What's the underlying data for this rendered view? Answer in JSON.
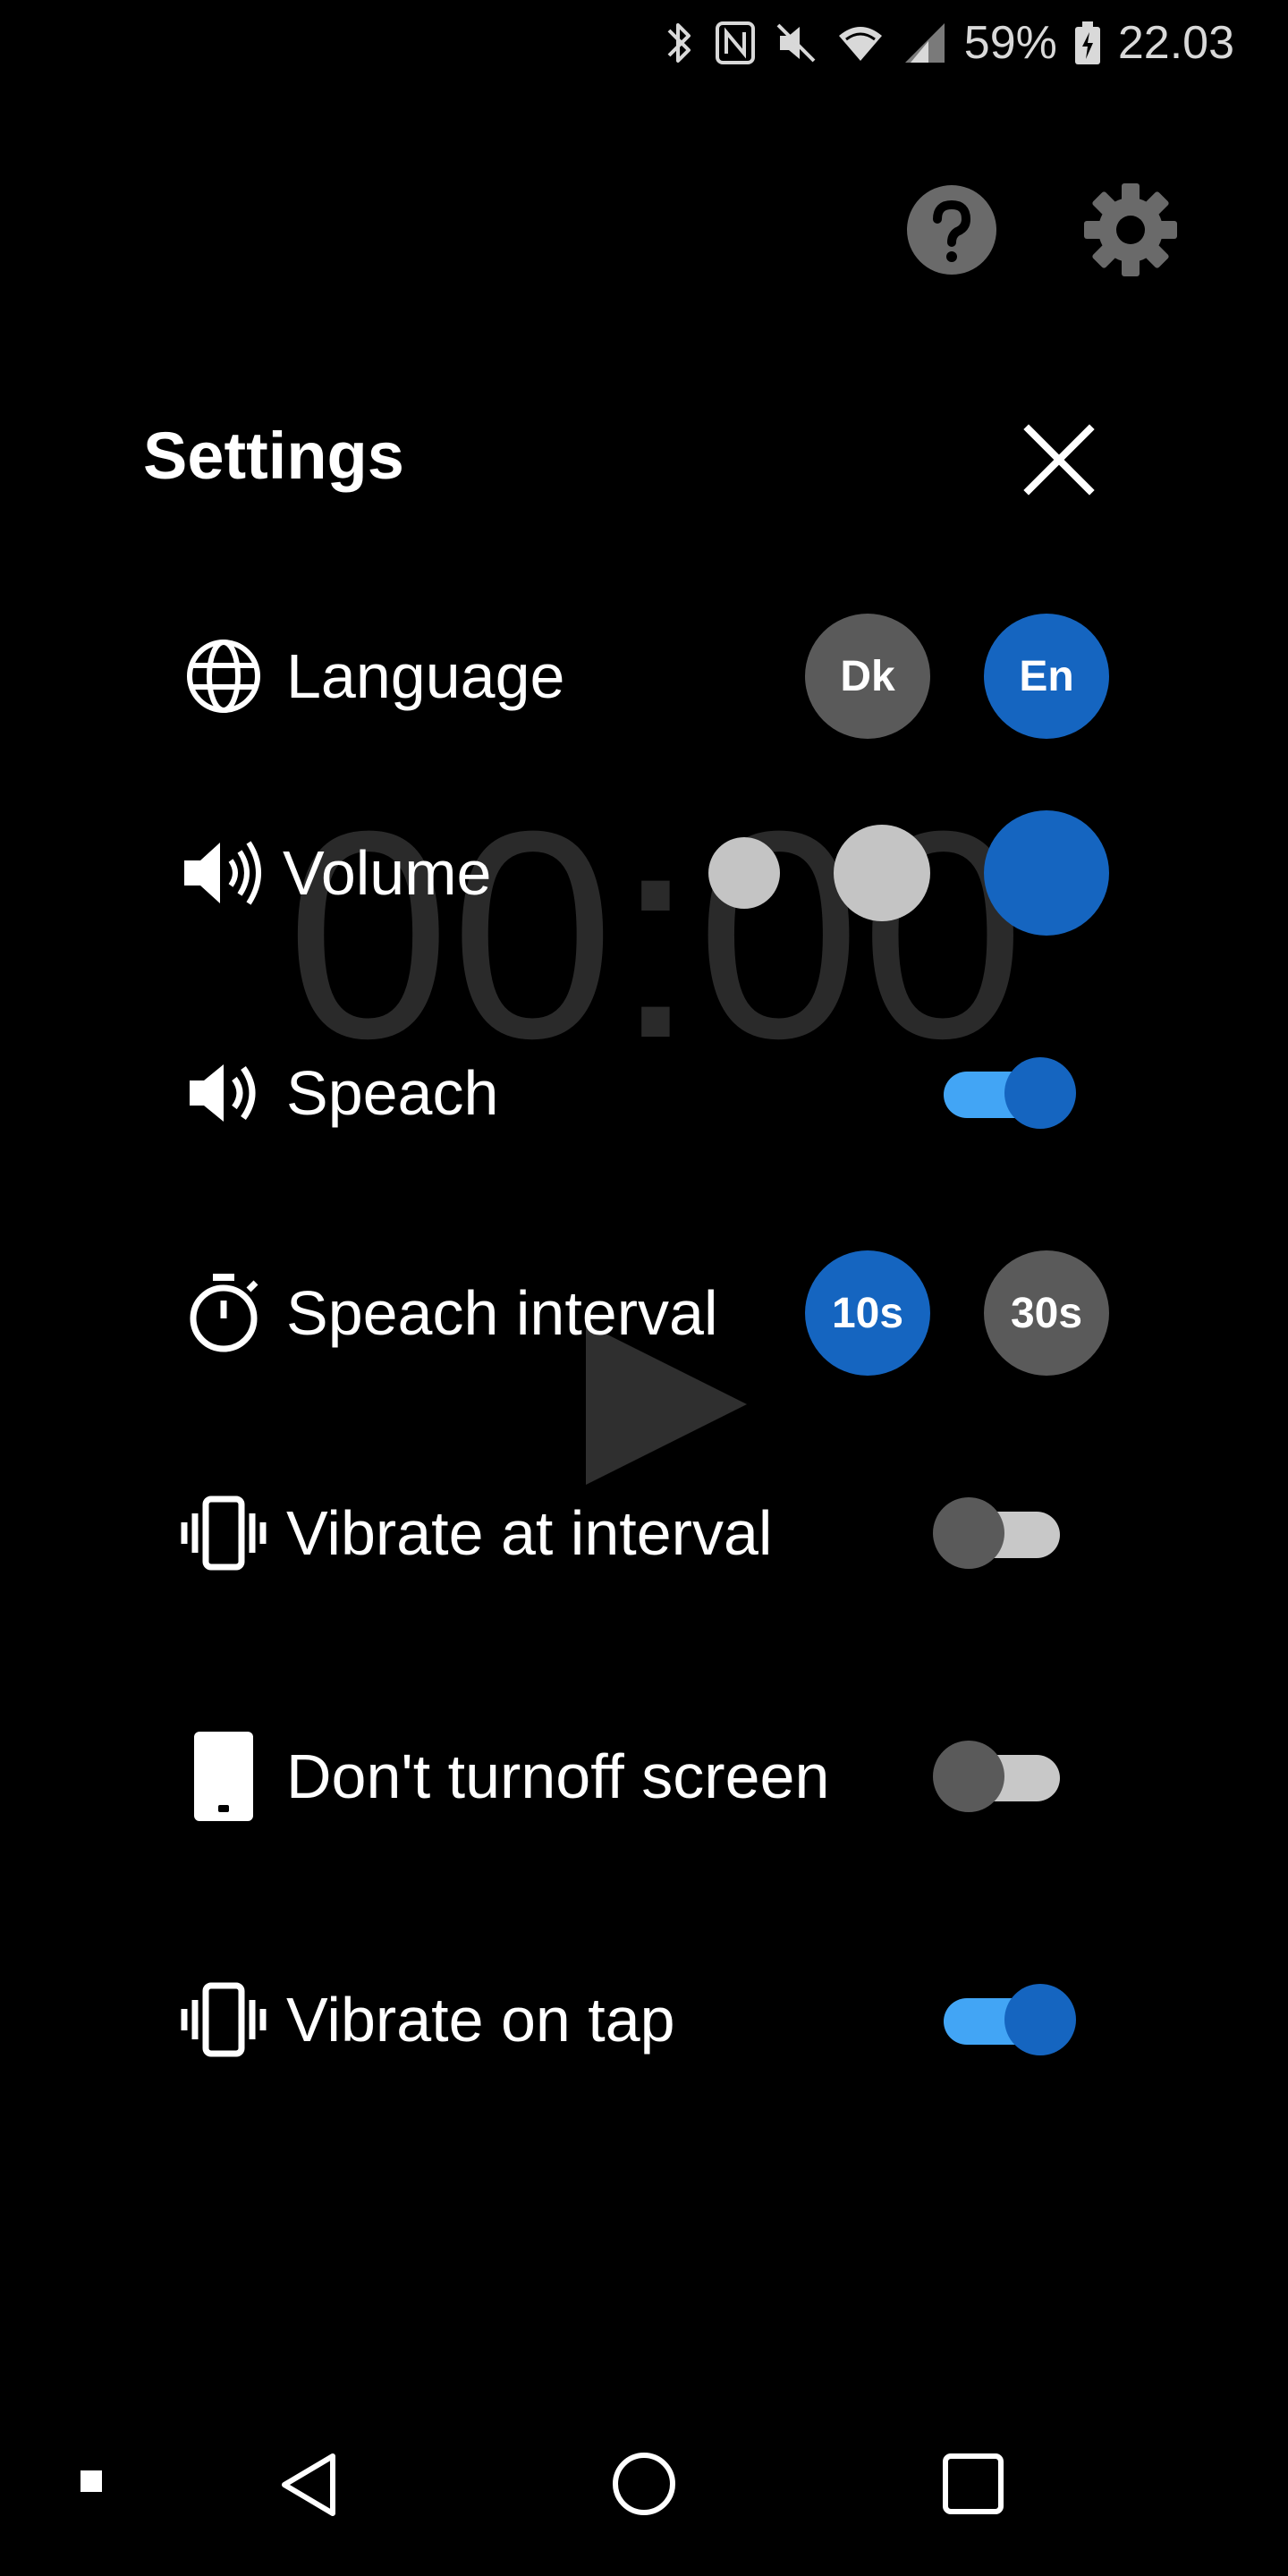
{
  "status_bar": {
    "battery_percent": "59%",
    "time": "22.03",
    "icons": [
      "bluetooth-icon",
      "nfc-icon",
      "mute-icon",
      "wifi-icon",
      "signal-icon",
      "battery-icon"
    ]
  },
  "top_actions": {
    "help_icon": "help-circle-icon",
    "settings_icon": "gear-icon"
  },
  "background": {
    "timer": "00:00",
    "play_icon": "play-icon"
  },
  "settings": {
    "title": "Settings",
    "close_icon": "close-icon",
    "rows": {
      "language": {
        "label": "Language",
        "icon": "globe-icon",
        "options": [
          "Dk",
          "En"
        ],
        "selected": "En"
      },
      "volume": {
        "label": "Volume",
        "icon": "volume-icon",
        "levels": 3,
        "selected_level": 3
      },
      "speach": {
        "label": "Speach",
        "icon": "speaker-icon",
        "enabled": true
      },
      "speach_interval": {
        "label": "Speach interval",
        "icon": "timer-icon",
        "options": [
          "10s",
          "30s"
        ],
        "selected": "10s"
      },
      "vibrate_interval": {
        "label": "Vibrate at interval",
        "icon": "vibrate-icon",
        "enabled": false
      },
      "screen_on": {
        "label": "Don't turnoff screen",
        "icon": "phone-icon",
        "enabled": false
      },
      "vibrate_tap": {
        "label": "Vibrate on tap",
        "icon": "vibrate-icon",
        "enabled": true
      }
    }
  },
  "colors": {
    "accent": "#1565c0",
    "toggle_on_track": "#42a5f5",
    "toggle_off_thumb": "#5a5a5a",
    "toggle_off_track": "#c8c8c8",
    "inactive_button": "#5a5a5a",
    "volume_inactive": "#c4c4c4"
  },
  "nav_bar": {
    "icons": [
      "dot-icon",
      "back-icon",
      "home-icon",
      "recents-icon"
    ]
  }
}
